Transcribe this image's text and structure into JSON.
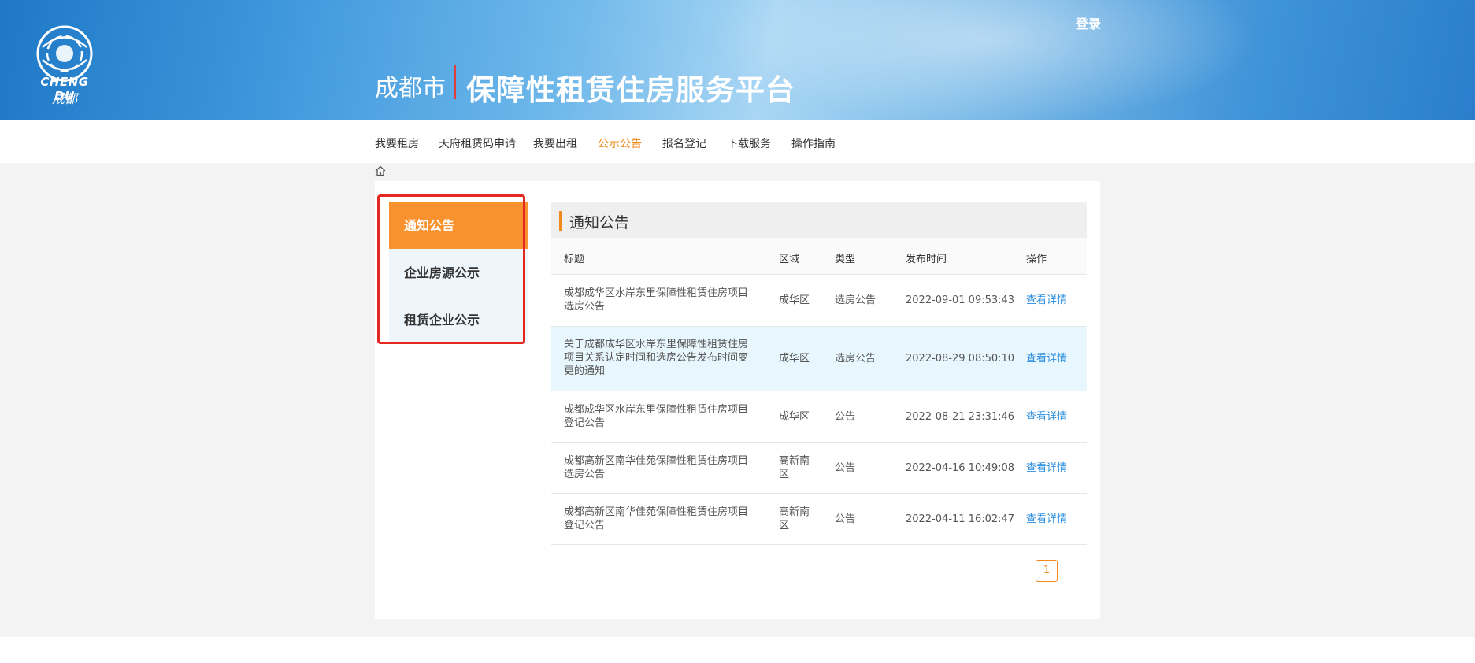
{
  "header": {
    "logo_text": "CHENG DU",
    "logo_sub": "成都",
    "city": "成都市",
    "platform_title": "保障性租赁住房服务平台",
    "login_label": "登录"
  },
  "nav": {
    "items": [
      {
        "label": "我要租房"
      },
      {
        "label": "天府租赁码申请"
      },
      {
        "label": "我要出租"
      },
      {
        "label": "公示公告"
      },
      {
        "label": "报名登记"
      },
      {
        "label": "下载服务"
      },
      {
        "label": "操作指南"
      }
    ],
    "active_index": 3
  },
  "sidebar": {
    "items": [
      {
        "label": "通知公告"
      },
      {
        "label": "企业房源公示"
      },
      {
        "label": "租赁企业公示"
      }
    ]
  },
  "content": {
    "title": "通知公告",
    "columns": [
      "标题",
      "区域",
      "类型",
      "发布时间",
      "操作"
    ],
    "rows": [
      {
        "title": "成都成华区水岸东里保障性租赁住房项目选房公告",
        "region": "成华区",
        "type": "选房公告",
        "time": "2022-09-01 09:53:43",
        "action": "查看详情"
      },
      {
        "title": "关于成都成华区水岸东里保障性租赁住房项目关系认定时间和选房公告发布时间变更的通知",
        "region": "成华区",
        "type": "选房公告",
        "time": "2022-08-29 08:50:10",
        "action": "查看详情"
      },
      {
        "title": "成都成华区水岸东里保障性租赁住房项目登记公告",
        "region": "成华区",
        "type": "公告",
        "time": "2022-08-21 23:31:46",
        "action": "查看详情"
      },
      {
        "title": "成都高新区南华佳苑保障性租赁住房项目选房公告",
        "region": "高新南区",
        "type": "公告",
        "time": "2022-04-16 10:49:08",
        "action": "查看详情"
      },
      {
        "title": "成都高新区南华佳苑保障性租赁住房项目登记公告",
        "region": "高新南区",
        "type": "公告",
        "time": "2022-04-11 16:02:47",
        "action": "查看详情"
      }
    ]
  },
  "pagination": {
    "current": "1"
  },
  "colors": {
    "accent": "#f18a1c",
    "link": "#2a8ee0",
    "highlight_border": "#e3281f"
  }
}
